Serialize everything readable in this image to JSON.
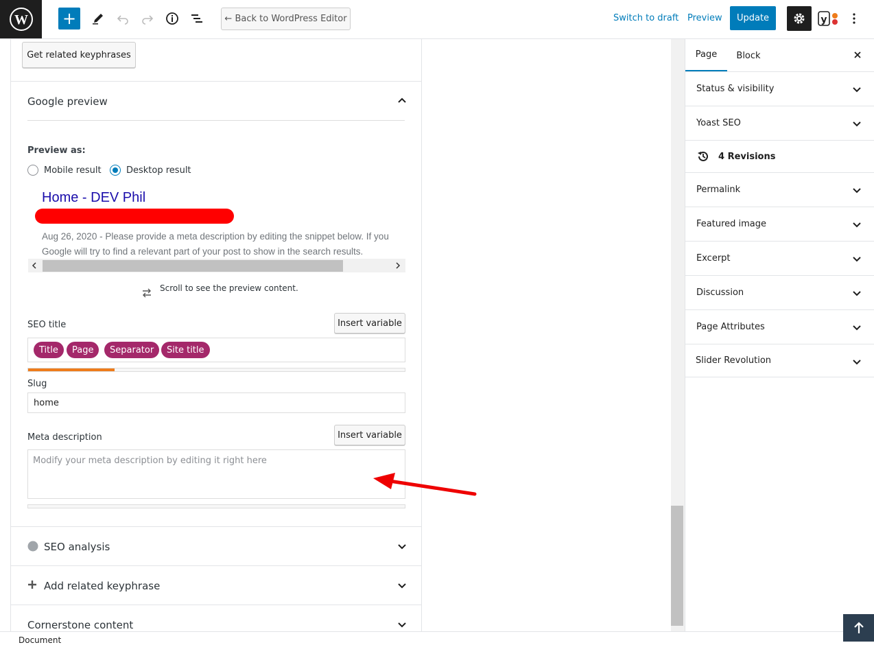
{
  "toolbar": {
    "back_label": "← Back to WordPress Editor",
    "switch_draft": "Switch to draft",
    "preview": "Preview",
    "update": "Update"
  },
  "panel": {
    "related_btn": "Get related keyphrases",
    "google_preview_title": "Google preview",
    "preview_as": "Preview as:",
    "mobile_label": "Mobile result",
    "desktop_label": "Desktop result",
    "selected_mode": "Desktop result",
    "gp_title": "Home - DEV Phil",
    "gp_desc_line1": "Aug 26, 2020 - Please provide a meta description by editing the snippet below. If you",
    "gp_desc_line2": "Google will try to find a relevant part of your post to show in the search results.",
    "scroll_hint": "Scroll to see the preview content.",
    "seo_title_label": "SEO title",
    "insert_variable": "Insert variable",
    "tags": [
      "Title",
      "Page",
      "Separator",
      "Site title"
    ],
    "seo_title_progress": 0.23,
    "slug_label": "Slug",
    "slug_value": "home",
    "meta_label": "Meta description",
    "meta_placeholder": "Modify your meta description by editing it right here",
    "seo_analysis": "SEO analysis",
    "add_related": "Add related keyphrase",
    "cornerstone": "Cornerstone content"
  },
  "sidebar": {
    "tab_page": "Page",
    "tab_block": "Block",
    "rows": [
      "Status & visibility",
      "Yoast SEO",
      "4 Revisions",
      "Permalink",
      "Featured image",
      "Excerpt",
      "Discussion",
      "Page Attributes",
      "Slider Revolution"
    ]
  },
  "footer": {
    "breadcrumb": "Document"
  },
  "colors": {
    "accent": "#007cba",
    "tag": "#a4286a",
    "progress_orange": "#ee7c1b",
    "link_blue": "#1a0dab"
  }
}
